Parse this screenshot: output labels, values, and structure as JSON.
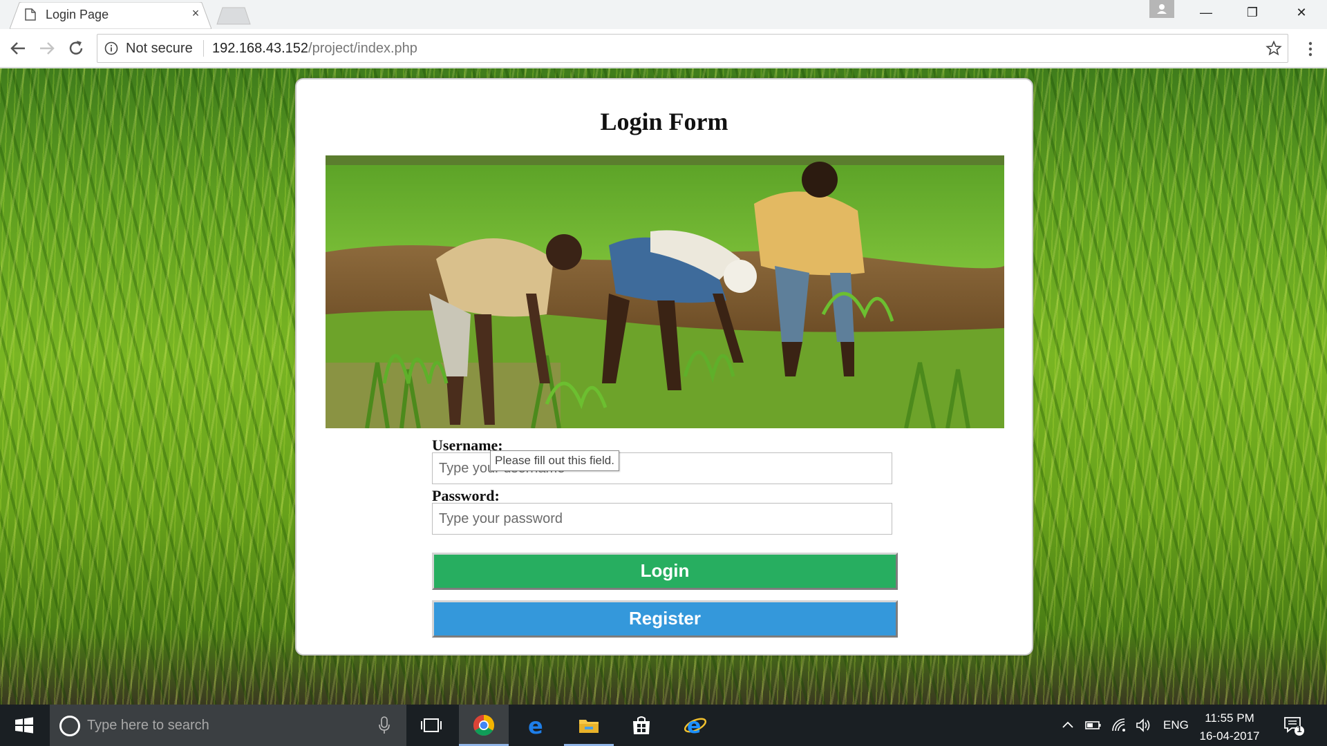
{
  "browser": {
    "tab_title": "Login Page",
    "tab_close": "×",
    "security_label": "Not secure",
    "url_host": "192.168.43.152",
    "url_path": "/project/index.php",
    "window_controls": {
      "minimize": "—",
      "restore": "❐",
      "close": "✕"
    }
  },
  "page": {
    "title": "Login Form",
    "hero_image": "farmers-planting-rice-photo",
    "username_label": "Username:",
    "username_placeholder": "Type your username",
    "password_label": "Password:",
    "password_placeholder": "Type your password",
    "validation_tooltip": "Please fill out this field.",
    "login_button": "Login",
    "register_button": "Register",
    "colors": {
      "login": "#27ae60",
      "register": "#3498db"
    }
  },
  "taskbar": {
    "search_placeholder": "Type here to search",
    "apps": [
      "task-view-icon",
      "chrome-icon",
      "edge-icon",
      "file-explorer-icon",
      "store-icon",
      "internet-explorer-icon"
    ],
    "language": "ENG",
    "time": "11:55 PM",
    "date": "16-04-2017",
    "notification_count": "1"
  }
}
